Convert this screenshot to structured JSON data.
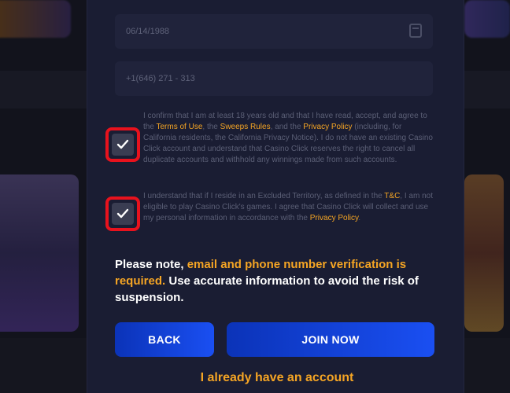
{
  "form": {
    "field_1_value": "06/14/1988",
    "field_2_value": "+1(646) 271 - 313"
  },
  "consent_1": {
    "text_a": "I confirm that I am at least 18 years old and that I have read, accept, and agree to the ",
    "terms_link": "Terms of Use",
    "text_b": ", the ",
    "sweeps_link": "Sweeps Rules",
    "text_c": ", and the ",
    "privacy_link": "Privacy Policy",
    "text_d": " (including, for California residents, the California Privacy Notice). I do not have an existing Casino Click account and understand that Casino Click reserves the right to cancel all duplicate accounts and withhold any winnings made from such accounts.",
    "checked": true
  },
  "consent_2": {
    "text_a": "I understand that if I reside in an Excluded Territory, as defined in the ",
    "tc_link": "T&C",
    "text_b": ", I am not eligible to play Casino Click's games. I agree that Casino Click will collect and use my personal information in accordance with the ",
    "privacy_link": "Privacy Policy",
    "text_c": ".",
    "checked": true
  },
  "note": {
    "prefix": "Please note, ",
    "warning": "email and phone number verification is required.",
    "suffix": " Use accurate information to avoid the risk of suspension."
  },
  "buttons": {
    "back": "BACK",
    "join": "JOIN NOW"
  },
  "have_account": "I already have an account",
  "colors": {
    "accent_orange": "#f5a524",
    "highlight_red": "#e8121d",
    "button_blue": "#1a4ff2",
    "modal_bg": "#1a1d33"
  }
}
